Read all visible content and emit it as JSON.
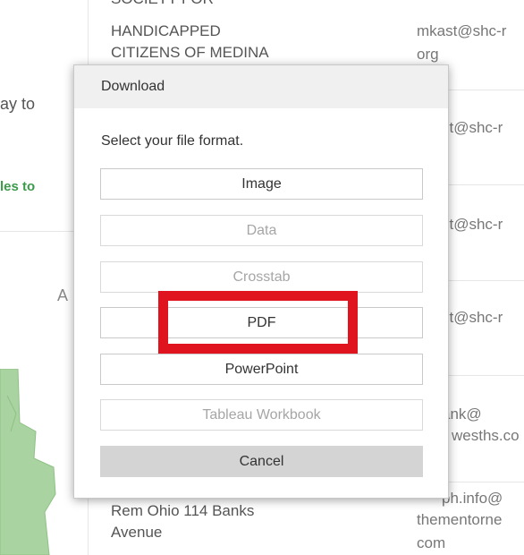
{
  "background": {
    "org_top_partial": "SOCIETY FOR",
    "org_lines": [
      "HANDICAPPED",
      "CITIZENS OF MEDINA"
    ],
    "left_partial_text": "ay to",
    "left_link_partial": "les to",
    "left_letter": "A",
    "emails": [
      {
        "line1": "mkast@shc-r",
        "line2": "org"
      },
      {
        "line1": "st@shc-r",
        "line2": ""
      },
      {
        "line1": "st@shc-r",
        "line2": ""
      },
      {
        "line1": "st@shc-r",
        "line2": ""
      },
      {
        "line1": "ank@",
        "line2": "wesths.co"
      },
      {
        "line1": "ph.info@",
        "line2": "thementorne",
        "line3": "com"
      }
    ],
    "bottom_org": [
      "Rem Ohio 114 Banks",
      "Avenue"
    ],
    "colors": {
      "link_green": "#3c9a4a",
      "map_green": "#a9d3a0"
    }
  },
  "dialog": {
    "title": "Download",
    "prompt": "Select your file format.",
    "buttons": [
      {
        "label": "Image",
        "enabled": true
      },
      {
        "label": "Data",
        "enabled": false
      },
      {
        "label": "Crosstab",
        "enabled": false
      },
      {
        "label": "PDF",
        "enabled": true,
        "highlighted": true
      },
      {
        "label": "PowerPoint",
        "enabled": true
      },
      {
        "label": "Tableau Workbook",
        "enabled": false
      }
    ],
    "cancel_label": "Cancel",
    "highlight_color": "#e0141f"
  }
}
